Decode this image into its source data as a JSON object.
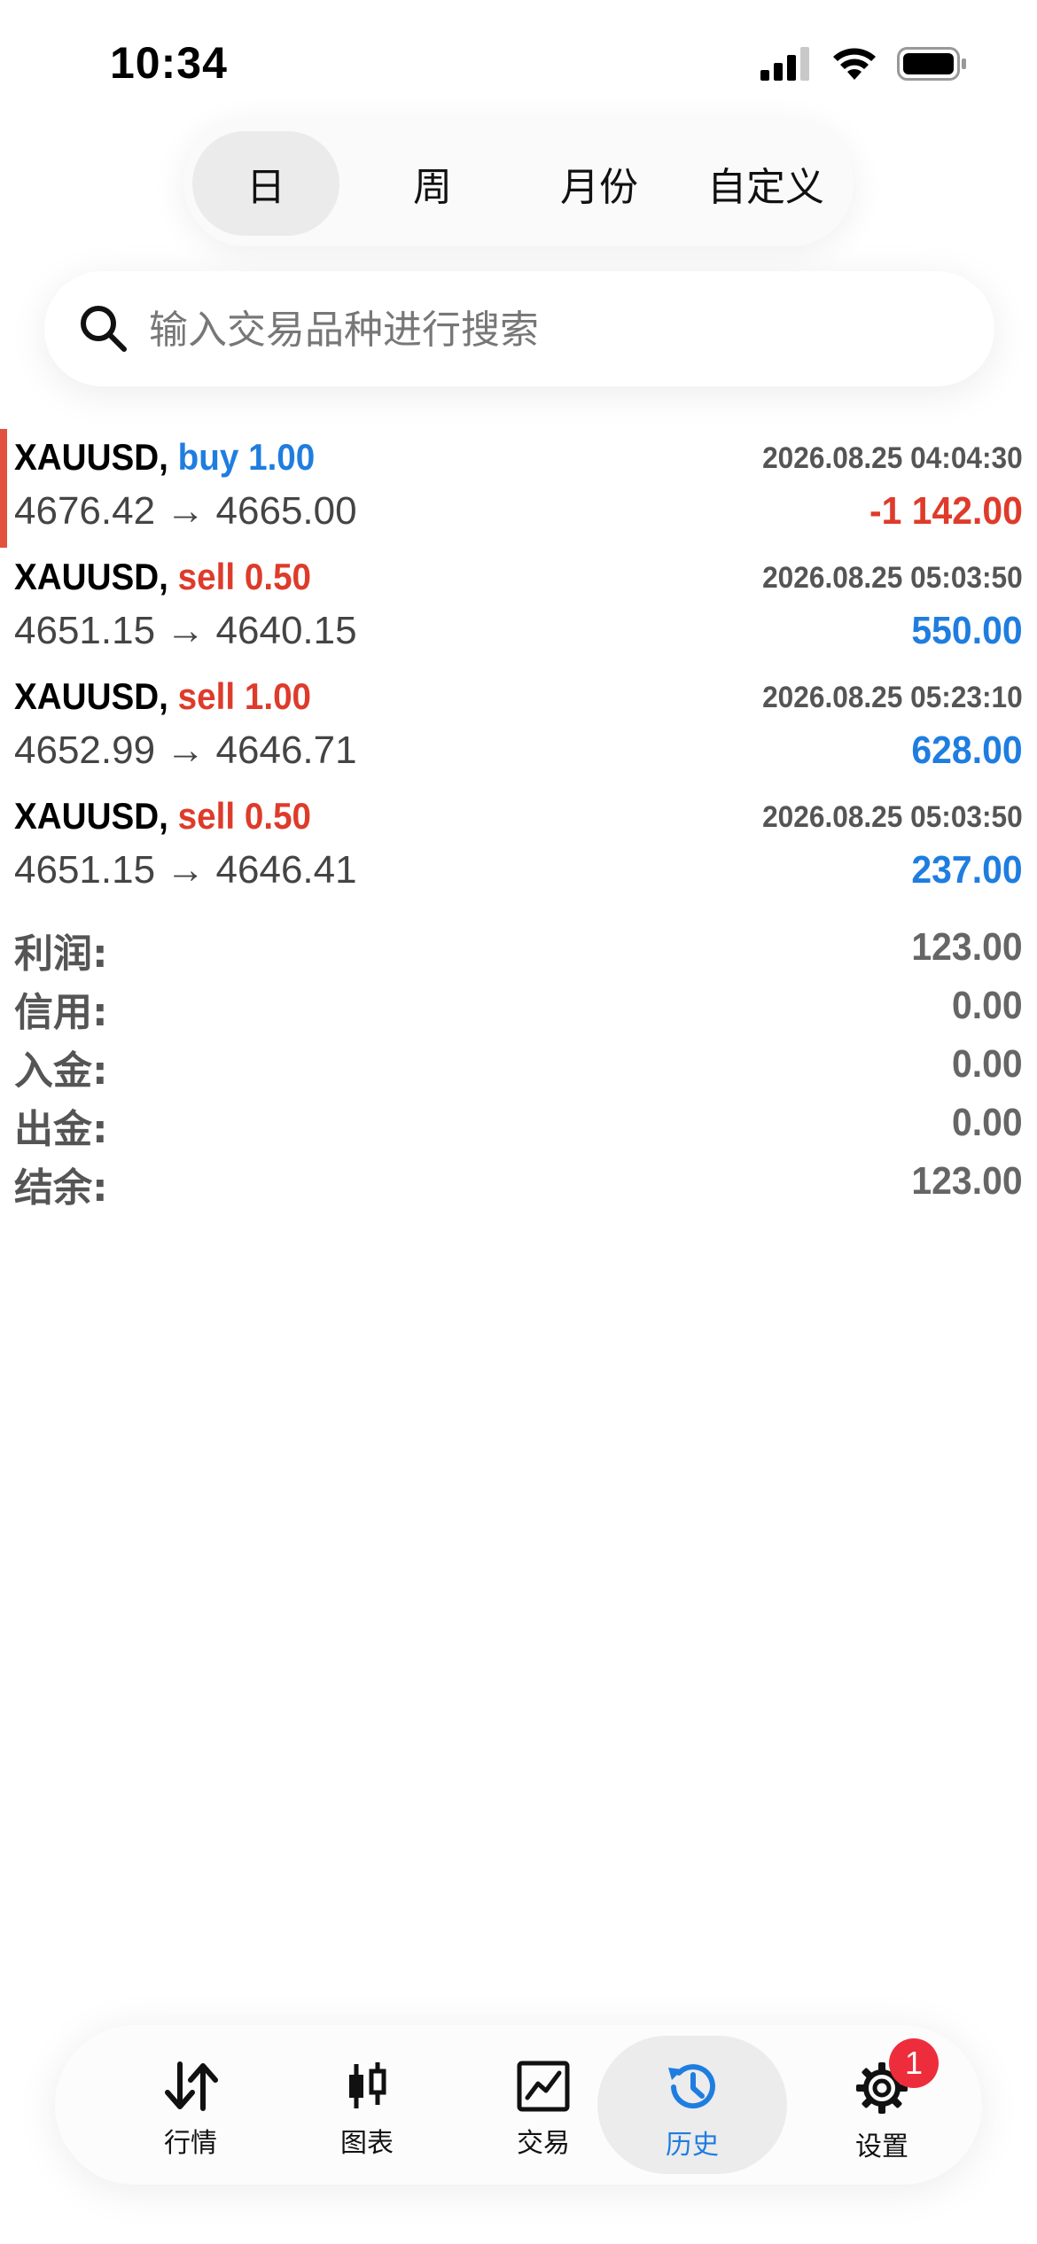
{
  "status_bar": {
    "time": "10:34"
  },
  "period_tabs": [
    {
      "label": "日",
      "active": true
    },
    {
      "label": "周",
      "active": false
    },
    {
      "label": "月份",
      "active": false
    },
    {
      "label": "自定义",
      "active": false
    }
  ],
  "search": {
    "placeholder": "输入交易品种进行搜索",
    "value": ""
  },
  "trades": [
    {
      "symbol": "XAUUSD,",
      "side": "buy",
      "volume": "1.00",
      "time": "2026.08.25 04:04:30",
      "open_price": "4676.42",
      "arrow": "→",
      "close_price": "4665.00",
      "profit": "-1 142.00",
      "profit_color": "#de3b2b"
    },
    {
      "symbol": "XAUUSD,",
      "side": "sell",
      "volume": "0.50",
      "time": "2026.08.25 05:03:50",
      "open_price": "4651.15",
      "arrow": "→",
      "close_price": "4640.15",
      "profit": "550.00",
      "profit_color": "#1f7de0"
    },
    {
      "symbol": "XAUUSD,",
      "side": "sell",
      "volume": "1.00",
      "time": "2026.08.25 05:23:10",
      "open_price": "4652.99",
      "arrow": "→",
      "close_price": "4646.71",
      "profit": "628.00",
      "profit_color": "#1f7de0"
    },
    {
      "symbol": "XAUUSD,",
      "side": "sell",
      "volume": "0.50",
      "time": "2026.08.25 05:03:50",
      "open_price": "4651.15",
      "arrow": "→",
      "close_price": "4646.41",
      "profit": "237.00",
      "profit_color": "#1f7de0"
    }
  ],
  "summary": [
    {
      "label": "利润:",
      "value": "123.00"
    },
    {
      "label": "信用:",
      "value": "0.00"
    },
    {
      "label": "入金:",
      "value": "0.00"
    },
    {
      "label": "出金:",
      "value": "0.00"
    },
    {
      "label": "结余:",
      "value": "123.00"
    }
  ],
  "bottom_nav": [
    {
      "label": "行情",
      "icon": "arrows-up-down-icon",
      "active": false
    },
    {
      "label": "图表",
      "icon": "candlestick-icon",
      "active": false
    },
    {
      "label": "交易",
      "icon": "trade-chart-icon",
      "active": false
    },
    {
      "label": "历史",
      "icon": "history-clock-icon",
      "active": true
    },
    {
      "label": "设置",
      "icon": "gear-icon",
      "active": false,
      "badge": "1"
    }
  ],
  "colors": {
    "accent_blue": "#1f7de0",
    "accent_red": "#de3b2b",
    "badge_red": "#ee2d3c"
  }
}
